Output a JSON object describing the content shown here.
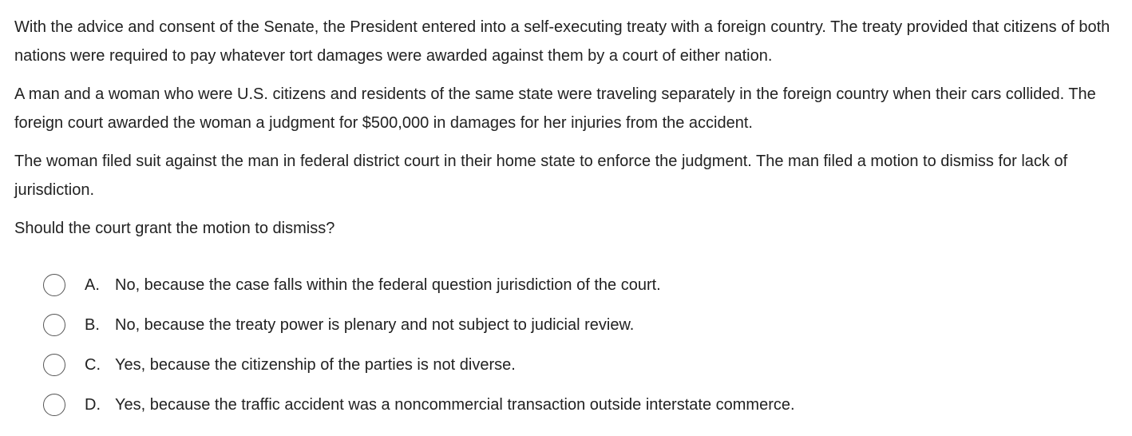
{
  "question": {
    "paragraphs": [
      "With the advice and consent of the Senate, the President entered into a self-executing treaty with a foreign country.  The treaty provided that citizens of both nations were required to pay whatever tort damages were awarded against them by a court of either nation.",
      "A man and a woman who were U.S. citizens and residents of the same state were traveling separately in the foreign country when their cars collided.  The foreign court awarded the woman a judgment for $500,000 in damages for her injuries from the accident.",
      "The woman filed suit against the man in federal district court in their home state to enforce the judgment.  The man filed a motion to dismiss for lack of jurisdiction.",
      "Should the court grant the motion to dismiss?"
    ]
  },
  "choices": [
    {
      "letter": "A.",
      "text": "No, because the case falls within the federal question jurisdiction of the court."
    },
    {
      "letter": "B.",
      "text": "No, because the treaty power is plenary and not subject to judicial review."
    },
    {
      "letter": "C.",
      "text": "Yes, because the citizenship of the parties is not diverse."
    },
    {
      "letter": "D.",
      "text": "Yes, because the traffic accident was a noncommercial transaction outside interstate commerce."
    }
  ]
}
